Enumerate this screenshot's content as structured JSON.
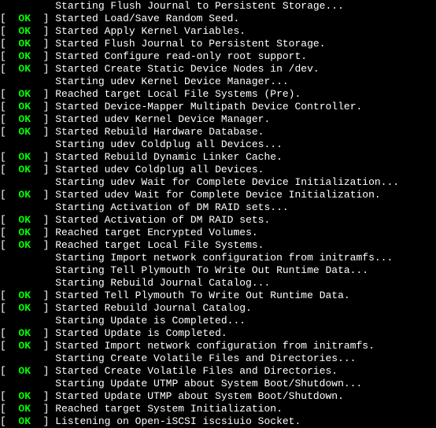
{
  "lines": [
    {
      "status": null,
      "indent": "         ",
      "text": "Starting Flush Journal to Persistent Storage..."
    },
    {
      "status": "OK",
      "indent": "",
      "text": "Started Load/Save Random Seed."
    },
    {
      "status": "OK",
      "indent": "",
      "text": "Started Apply Kernel Variables."
    },
    {
      "status": "OK",
      "indent": "",
      "text": "Started Flush Journal to Persistent Storage."
    },
    {
      "status": "OK",
      "indent": "",
      "text": "Started Configure read-only root support."
    },
    {
      "status": "OK",
      "indent": "",
      "text": "Started Create Static Device Nodes in /dev."
    },
    {
      "status": null,
      "indent": "         ",
      "text": "Starting udev Kernel Device Manager..."
    },
    {
      "status": "OK",
      "indent": "",
      "text": "Reached target Local File Systems (Pre)."
    },
    {
      "status": "OK",
      "indent": "",
      "text": "Started Device-Mapper Multipath Device Controller."
    },
    {
      "status": "OK",
      "indent": "",
      "text": "Started udev Kernel Device Manager."
    },
    {
      "status": "OK",
      "indent": "",
      "text": "Started Rebuild Hardware Database."
    },
    {
      "status": null,
      "indent": "         ",
      "text": "Starting udev Coldplug all Devices..."
    },
    {
      "status": "OK",
      "indent": "",
      "text": "Started Rebuild Dynamic Linker Cache."
    },
    {
      "status": "OK",
      "indent": "",
      "text": "Started udev Coldplug all Devices."
    },
    {
      "status": null,
      "indent": "         ",
      "text": "Starting udev Wait for Complete Device Initialization..."
    },
    {
      "status": "OK",
      "indent": "",
      "text": "Started udev Wait for Complete Device Initialization."
    },
    {
      "status": null,
      "indent": "         ",
      "text": "Starting Activation of DM RAID sets..."
    },
    {
      "status": "OK",
      "indent": "",
      "text": "Started Activation of DM RAID sets."
    },
    {
      "status": "OK",
      "indent": "",
      "text": "Reached target Encrypted Volumes."
    },
    {
      "status": "OK",
      "indent": "",
      "text": "Reached target Local File Systems."
    },
    {
      "status": null,
      "indent": "         ",
      "text": "Starting Import network configuration from initramfs..."
    },
    {
      "status": null,
      "indent": "         ",
      "text": "Starting Tell Plymouth To Write Out Runtime Data..."
    },
    {
      "status": null,
      "indent": "         ",
      "text": "Starting Rebuild Journal Catalog..."
    },
    {
      "status": "OK",
      "indent": "",
      "text": "Started Tell Plymouth To Write Out Runtime Data."
    },
    {
      "status": "OK",
      "indent": "",
      "text": "Started Rebuild Journal Catalog."
    },
    {
      "status": null,
      "indent": "         ",
      "text": "Starting Update is Completed..."
    },
    {
      "status": "OK",
      "indent": "",
      "text": "Started Update is Completed."
    },
    {
      "status": "OK",
      "indent": "",
      "text": "Started Import network configuration from initramfs."
    },
    {
      "status": null,
      "indent": "         ",
      "text": "Starting Create Volatile Files and Directories..."
    },
    {
      "status": "OK",
      "indent": "",
      "text": "Started Create Volatile Files and Directories."
    },
    {
      "status": null,
      "indent": "         ",
      "text": "Starting Update UTMP about System Boot/Shutdown..."
    },
    {
      "status": "OK",
      "indent": "",
      "text": "Started Update UTMP about System Boot/Shutdown."
    },
    {
      "status": "OK",
      "indent": "",
      "text": "Reached target System Initialization."
    },
    {
      "status": "OK",
      "indent": "",
      "text": "Listening on Open-iSCSI iscsiuio Socket."
    }
  ],
  "status_label": "OK"
}
